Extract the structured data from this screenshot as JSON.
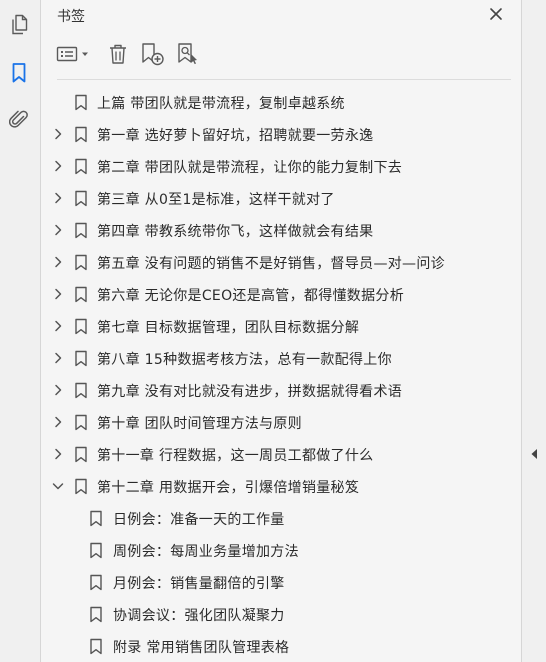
{
  "panel": {
    "title": "书签"
  },
  "left_rail": {
    "items": [
      {
        "icon": "page-thumbnails-icon"
      },
      {
        "icon": "bookmark-icon"
      },
      {
        "icon": "attachment-icon"
      }
    ]
  },
  "toolbar": {
    "items": [
      {
        "icon": "options-menu-icon"
      },
      {
        "icon": "delete-icon"
      },
      {
        "icon": "add-bookmark-icon"
      },
      {
        "icon": "find-bookmark-icon"
      }
    ]
  },
  "bookmarks": [
    {
      "label": "上篇  带团队就是带流程，复制卓越系统",
      "level": 0,
      "expander": "none"
    },
    {
      "label": "第一章  选好萝卜留好坑，招聘就要一劳永逸",
      "level": 0,
      "expander": "collapsed"
    },
    {
      "label": "第二章  带团队就是带流程，让你的能力复制下去",
      "level": 0,
      "expander": "collapsed"
    },
    {
      "label": "第三章  从0至1是标准，这样干就对了",
      "level": 0,
      "expander": "collapsed"
    },
    {
      "label": "第四章  带教系统带你飞，这样做就会有结果",
      "level": 0,
      "expander": "collapsed"
    },
    {
      "label": "第五章  没有问题的销售不是好销售，督导员—对—问诊",
      "level": 0,
      "expander": "collapsed"
    },
    {
      "label": "第六章  无论你是CEO还是高管，都得懂数据分析",
      "level": 0,
      "expander": "collapsed"
    },
    {
      "label": "第七章  目标数据管理，团队目标数据分解",
      "level": 0,
      "expander": "collapsed"
    },
    {
      "label": "第八章  15种数据考核方法，总有一款配得上你",
      "level": 0,
      "expander": "collapsed"
    },
    {
      "label": "第九章  没有对比就没有进步，拼数据就得看术语",
      "level": 0,
      "expander": "collapsed"
    },
    {
      "label": "第十章  团队时间管理方法与原则",
      "level": 0,
      "expander": "collapsed"
    },
    {
      "label": "第十一章  行程数据，这一周员工都做了什么",
      "level": 0,
      "expander": "collapsed"
    },
    {
      "label": "第十二章  用数据开会，引爆倍增销量秘笈",
      "level": 0,
      "expander": "expanded"
    },
    {
      "label": "日例会：准备一天的工作量",
      "level": 1,
      "expander": "none"
    },
    {
      "label": "周例会：每周业务量增加方法",
      "level": 1,
      "expander": "none"
    },
    {
      "label": "月例会：销售量翻倍的引擎",
      "level": 1,
      "expander": "none"
    },
    {
      "label": "协调会议：强化团队凝聚力",
      "level": 1,
      "expander": "none"
    },
    {
      "label": "附录  常用销售团队管理表格",
      "level": 1,
      "expander": "none"
    }
  ],
  "colors": {
    "accent": "#1a73e8",
    "icon": "#5a5a5a",
    "text": "#2b2b2b"
  }
}
